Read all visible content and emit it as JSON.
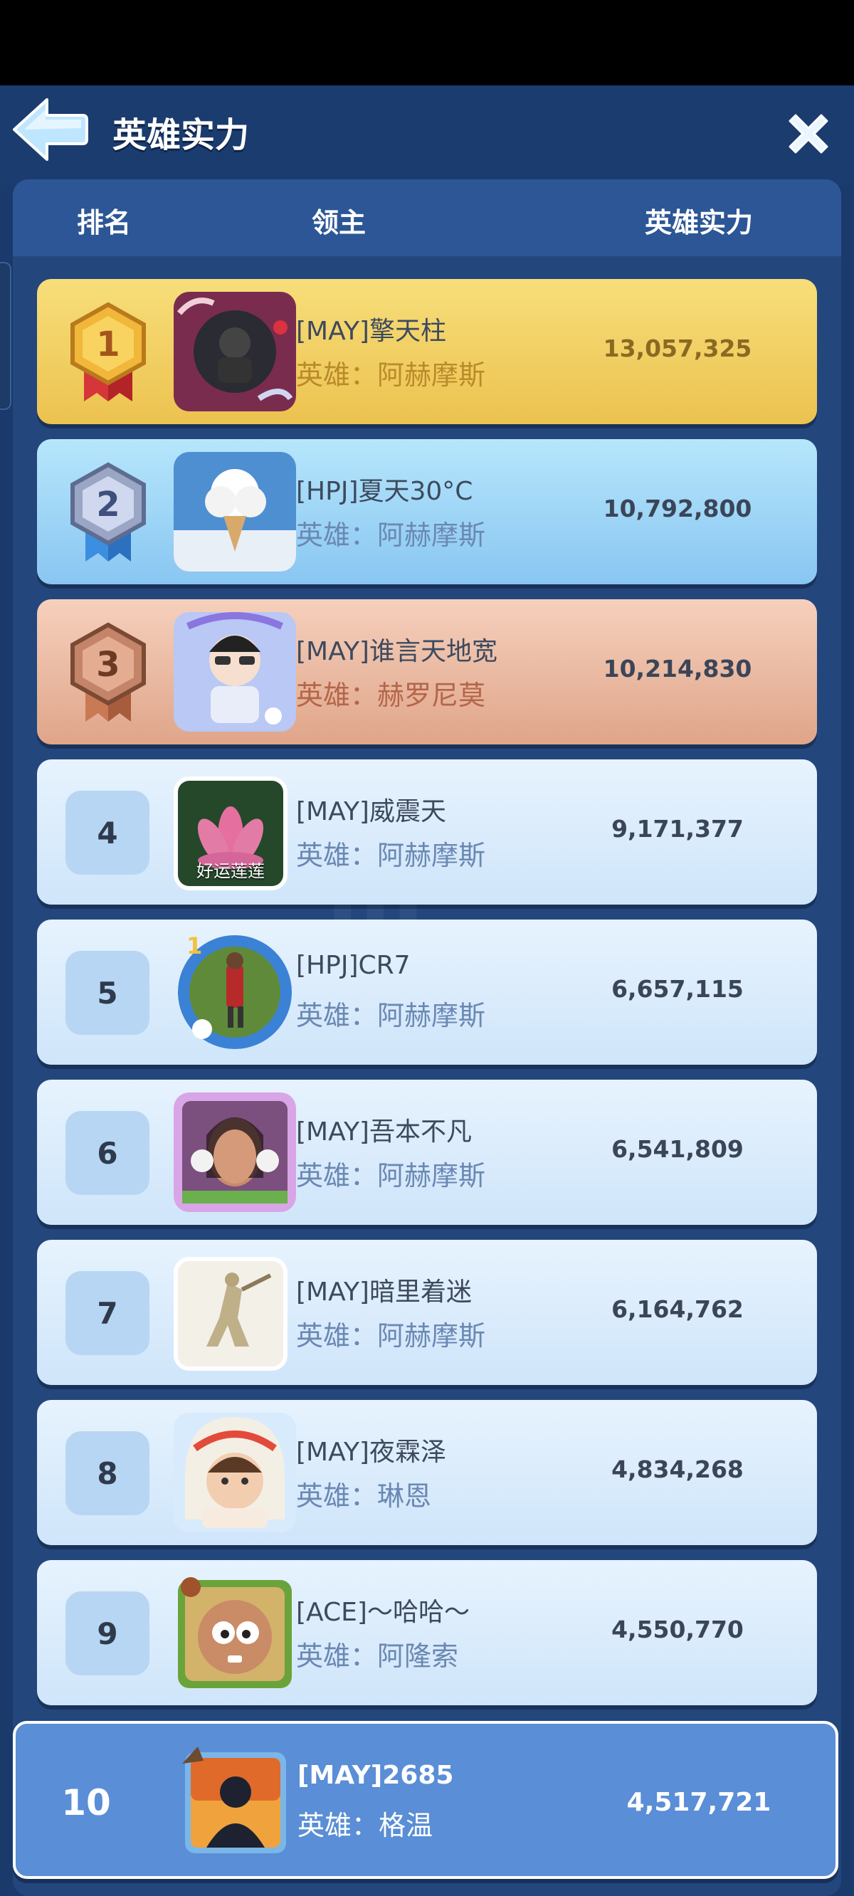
{
  "header": {
    "title": "英雄实力"
  },
  "columns": {
    "rank": "排名",
    "lord": "领主",
    "power": "英雄实力"
  },
  "rows": [
    {
      "rank": "1",
      "name": "[MAY]擎天柱",
      "hero": "英雄：阿赫摩斯",
      "power": "13,057,325"
    },
    {
      "rank": "2",
      "name": "[HPJ]夏天30°C",
      "hero": "英雄：阿赫摩斯",
      "power": "10,792,800"
    },
    {
      "rank": "3",
      "name": "[MAY]谁言天地宽",
      "hero": "英雄：赫罗尼莫",
      "power": "10,214,830"
    },
    {
      "rank": "4",
      "name": "[MAY]威震天",
      "hero": "英雄：阿赫摩斯",
      "power": "9,171,377",
      "avatar_label": "好运莲莲"
    },
    {
      "rank": "5",
      "name": "[HPJ]CR7",
      "hero": "英雄：阿赫摩斯",
      "power": "6,657,115"
    },
    {
      "rank": "6",
      "name": "[MAY]吾本不凡",
      "hero": "英雄：阿赫摩斯",
      "power": "6,541,809"
    },
    {
      "rank": "7",
      "name": "[MAY]暗里着迷",
      "hero": "英雄：阿赫摩斯",
      "power": "6,164,762"
    },
    {
      "rank": "8",
      "name": "[MAY]夜霖泽",
      "hero": "英雄：琳恩",
      "power": "4,834,268"
    },
    {
      "rank": "9",
      "name": "[ACE]～哈哈～",
      "hero": "英雄：阿隆索",
      "power": "4,550,770"
    }
  ],
  "my_row": {
    "rank": "10",
    "name": "[MAY]2685",
    "hero": "英雄：格温",
    "power": "4,517,721"
  },
  "icons": {
    "back": "back-arrow-icon",
    "close": "close-icon",
    "medal_gold": "gold-medal-icon",
    "medal_silver": "silver-medal-icon",
    "medal_bronze": "bronze-medal-icon"
  },
  "colors": {
    "background": "#1a3a6b",
    "header_bar": "#2c5695",
    "gold": "#ecc24f",
    "silver": "#89c6f2",
    "bronze": "#dfa589",
    "plain_row": "#d8ebfc",
    "my_row": "#5a8ed6"
  }
}
